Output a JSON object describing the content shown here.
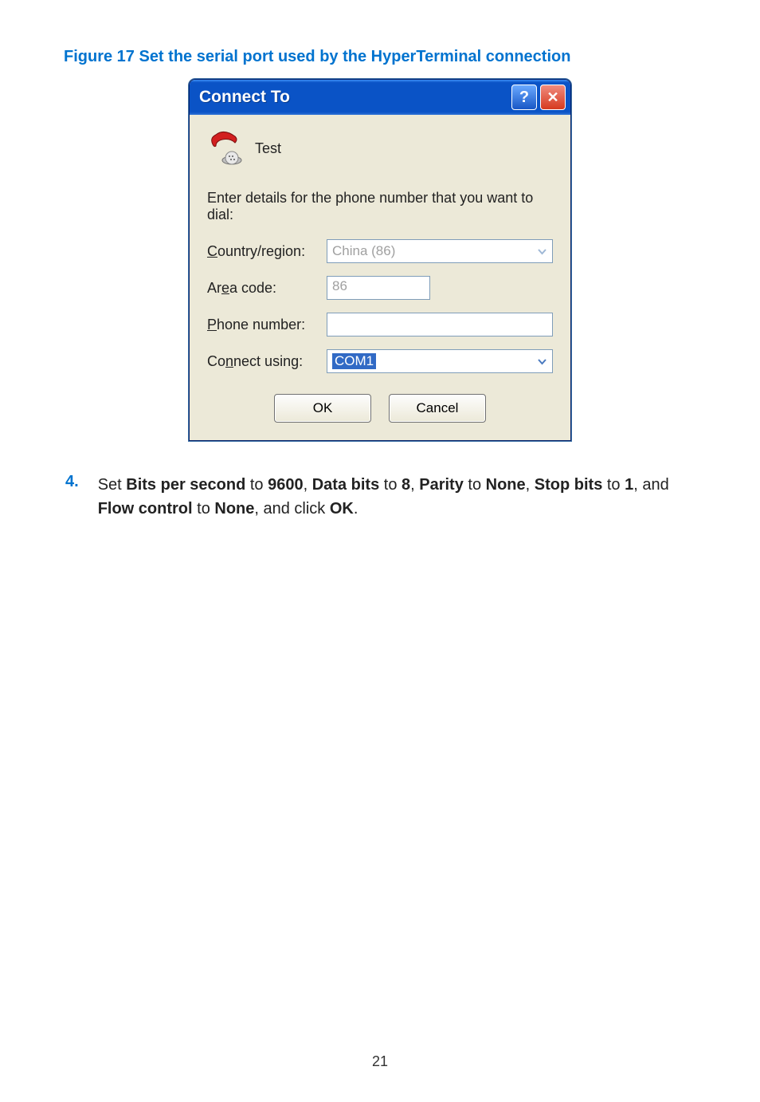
{
  "figure_caption": "Figure 17 Set the serial port used by the HyperTerminal connection",
  "dialog": {
    "title": "Connect To",
    "help_glyph": "?",
    "close_glyph": "✕",
    "icon_name": "phone-icon",
    "icon_label_text": "Test",
    "instruction": "Enter details for the phone number that you want to dial:",
    "fields": {
      "country_label_pre": "C",
      "country_label_post": "ountry/region:",
      "country_value": "China (86)",
      "area_label_pre": "Ar",
      "area_label_u": "e",
      "area_label_post": "a code:",
      "area_value": "86",
      "phone_label_pre": "P",
      "phone_label_post": "hone number:",
      "phone_value": "",
      "connect_label_pre": "Co",
      "connect_label_u": "n",
      "connect_label_post": "nect using:",
      "connect_value": "COM1"
    },
    "buttons": {
      "ok": "OK",
      "cancel": "Cancel"
    }
  },
  "step": {
    "number": "4.",
    "t1": "Set ",
    "b1": "Bits per second",
    "t2": " to ",
    "b2": "9600",
    "t3": ", ",
    "b3": "Data bits",
    "t4": " to ",
    "b4": "8",
    "t5": ", ",
    "b5": "Parity",
    "t6": " to ",
    "b6": "None",
    "t7": ", ",
    "b7": "Stop bits",
    "t8": " to ",
    "b8": "1",
    "t9": ", and ",
    "b9": "Flow control",
    "t10": " to ",
    "b10": "None",
    "t11": ", and click ",
    "b11": "OK",
    "t12": "."
  },
  "page_number": "21"
}
